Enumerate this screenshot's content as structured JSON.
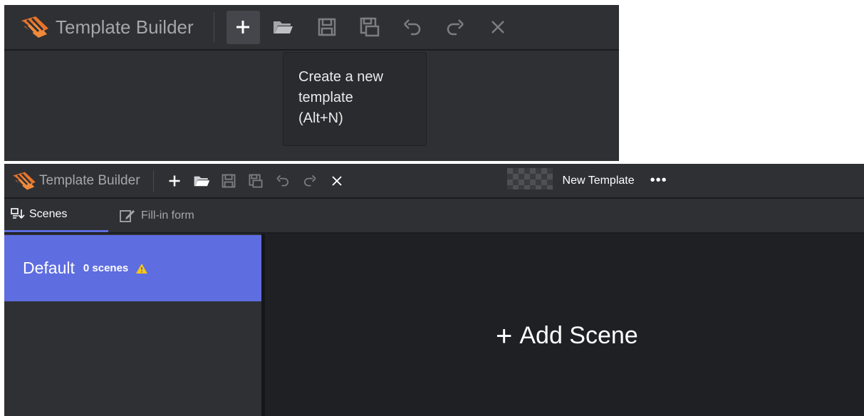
{
  "top": {
    "app_title": "Template Builder",
    "toolbar": [
      {
        "icon": "plus-icon",
        "label": "New"
      },
      {
        "icon": "folder-open-icon",
        "label": "Open"
      },
      {
        "icon": "save-icon",
        "label": "Save"
      },
      {
        "icon": "save-as-icon",
        "label": "Save As"
      },
      {
        "icon": "undo-icon",
        "label": "Undo"
      },
      {
        "icon": "redo-icon",
        "label": "Redo"
      },
      {
        "icon": "close-icon",
        "label": "Close"
      }
    ],
    "tooltip": {
      "lines": [
        "Create a new",
        "template",
        "(Alt+N)"
      ]
    }
  },
  "bottom": {
    "app_title": "Template Builder",
    "template_name": "New Template",
    "more_label": "•••",
    "tabs": [
      {
        "label": "Scenes",
        "icon": "scenes-icon",
        "active": true
      },
      {
        "label": "Fill-in form",
        "icon": "edit-form-icon",
        "active": false
      }
    ],
    "groups": [
      {
        "name": "Default",
        "count": "0 scenes",
        "warning": true
      }
    ],
    "add_scene": {
      "plus": "+",
      "label": "Add Scene"
    }
  },
  "colors": {
    "background": "#2f3034",
    "canvas": "#1f2024",
    "accent": "#5e6de0",
    "logo": "#e8742a",
    "warning": "#f5c518",
    "icon": "#a5a6aa"
  }
}
